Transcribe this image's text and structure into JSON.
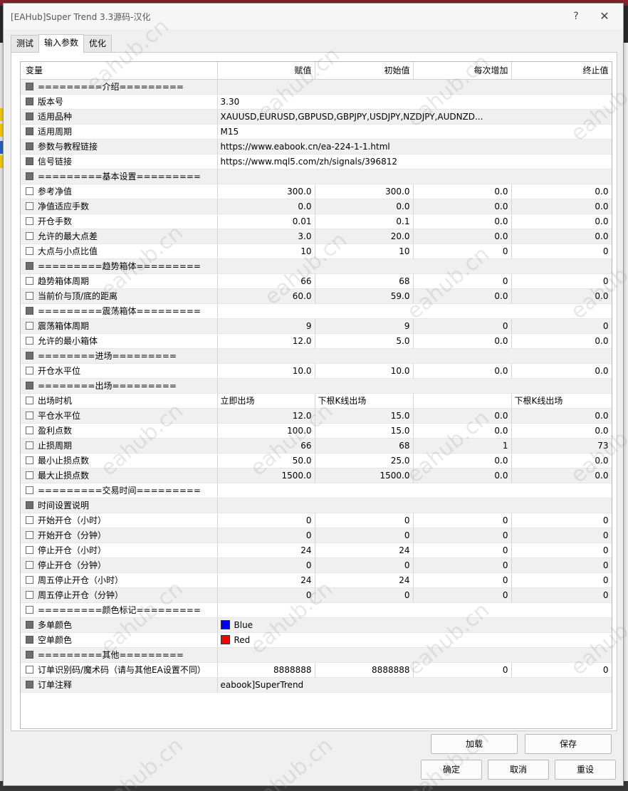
{
  "window": {
    "title": "[EAHub]Super Trend 3.3源码-汉化",
    "help_glyph": "?",
    "close_glyph": "✕"
  },
  "tabs": [
    "测试",
    "输入参数",
    "优化"
  ],
  "active_tab": 1,
  "columns": [
    "变量",
    "赋值",
    "初始值",
    "每次增加",
    "终止值"
  ],
  "rows": [
    {
      "name": "=========介绍=========",
      "section": true
    },
    {
      "name": "版本号",
      "section": true,
      "text": "3.30"
    },
    {
      "name": "适用品种",
      "section": true,
      "text": "XAUUSD,EURUSD,GBPUSD,GBPJPY,USDJPY,NZDJPY,AUDNZD..."
    },
    {
      "name": "适用周期",
      "section": true,
      "text": "M15"
    },
    {
      "name": "参数与教程链接",
      "section": true,
      "text": "https://www.eabook.cn/ea-224-1-1.html"
    },
    {
      "name": "信号链接",
      "section": true,
      "text": "https://www.mql5.com/zh/signals/396812"
    },
    {
      "name": "=========基本设置=========",
      "section": true
    },
    {
      "name": "参考净值",
      "values": [
        "300.0",
        "300.0",
        "0.0",
        "0.0"
      ]
    },
    {
      "name": "净值适应手数",
      "values": [
        "0.0",
        "0.0",
        "0.0",
        "0.0"
      ]
    },
    {
      "name": "开仓手数",
      "values": [
        "0.01",
        "0.1",
        "0.0",
        "0.0"
      ]
    },
    {
      "name": "允许的最大点差",
      "values": [
        "3.0",
        "20.0",
        "0.0",
        "0.0"
      ]
    },
    {
      "name": "大点与小点比值",
      "values": [
        "10",
        "10",
        "0",
        "0"
      ]
    },
    {
      "name": "=========趋势箱体=========",
      "section": true
    },
    {
      "name": "趋势箱体周期",
      "values": [
        "66",
        "68",
        "0",
        "0"
      ]
    },
    {
      "name": "当前价与顶/底的距离",
      "values": [
        "60.0",
        "59.0",
        "0.0",
        "0.0"
      ]
    },
    {
      "name": "=========震荡箱体=========",
      "section": true
    },
    {
      "name": "震荡箱体周期",
      "values": [
        "9",
        "9",
        "0",
        "0"
      ]
    },
    {
      "name": "允许的最小箱体",
      "values": [
        "12.0",
        "5.0",
        "0.0",
        "0.0"
      ]
    },
    {
      "name": "========进场=========",
      "section": true
    },
    {
      "name": "开仓水平位",
      "values": [
        "10.0",
        "10.0",
        "0.0",
        "0.0"
      ]
    },
    {
      "name": "========出场=========",
      "section": true
    },
    {
      "name": "出场时机",
      "left_values": [
        "立即出场",
        "下根K线出场",
        "",
        "下根K线出场"
      ]
    },
    {
      "name": "平仓水平位",
      "values": [
        "12.0",
        "15.0",
        "0.0",
        "0.0"
      ]
    },
    {
      "name": "盈利点数",
      "values": [
        "100.0",
        "15.0",
        "0.0",
        "0.0"
      ]
    },
    {
      "name": "止损周期",
      "values": [
        "66",
        "68",
        "1",
        "73"
      ]
    },
    {
      "name": "最小止损点数",
      "values": [
        "50.0",
        "25.0",
        "0.0",
        "0.0"
      ]
    },
    {
      "name": "最大止损点数",
      "values": [
        "1500.0",
        "1500.0",
        "0.0",
        "0.0"
      ]
    },
    {
      "name": "=========交易时间=========",
      "section": false
    },
    {
      "name": "时间设置说明",
      "section": true
    },
    {
      "name": "开始开仓（小时）",
      "values": [
        "0",
        "0",
        "0",
        "0"
      ]
    },
    {
      "name": "开始开仓（分钟）",
      "values": [
        "0",
        "0",
        "0",
        "0"
      ]
    },
    {
      "name": "停止开仓（小时）",
      "values": [
        "24",
        "24",
        "0",
        "0"
      ]
    },
    {
      "name": "停止开仓（分钟）",
      "values": [
        "0",
        "0",
        "0",
        "0"
      ]
    },
    {
      "name": "周五停止开仓（小时）",
      "values": [
        "24",
        "24",
        "0",
        "0"
      ]
    },
    {
      "name": "周五停止开仓（分钟）",
      "values": [
        "0",
        "0",
        "0",
        "0"
      ]
    },
    {
      "name": "=========颜色标记=========",
      "section": false
    },
    {
      "name": "多单颜色",
      "section": true,
      "text": "Blue",
      "color": "#0000ff"
    },
    {
      "name": "空单颜色",
      "section": true,
      "text": "Red",
      "color": "#ff0000"
    },
    {
      "name": "=========其他=========",
      "section": true
    },
    {
      "name": "订单识别码/魔术码（请与其他EA设置不同）",
      "values": [
        "8888888",
        "8888888",
        "0",
        "0"
      ]
    },
    {
      "name": "订单注释",
      "section": true,
      "text": "eabook]SuperTrend"
    }
  ],
  "buttons": {
    "load": "加载",
    "save": "保存",
    "ok": "确定",
    "cancel": "取消",
    "reset": "重设"
  },
  "watermark": "eahub.cn",
  "colors": {
    "row_alt": "#f0f0f0",
    "section_checkbox": "#6e6e6e",
    "background_strip": "#8e1f28"
  }
}
